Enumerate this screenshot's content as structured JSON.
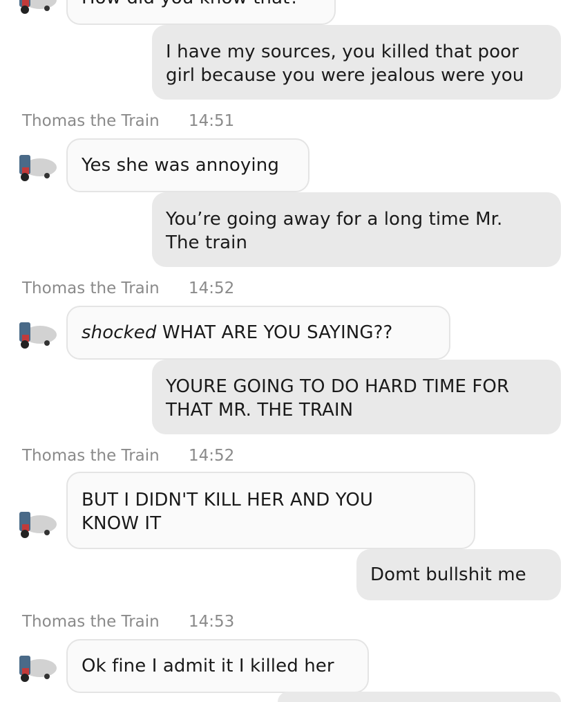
{
  "contact": {
    "name": "Thomas the Train"
  },
  "messages": [
    {
      "id": 0,
      "direction": "incoming",
      "text": "How did you know that?"
    },
    {
      "id": 1,
      "direction": "outgoing",
      "text_lines": [
        "I have my sources, you killed that poor",
        "girl because you were jealous were you"
      ]
    },
    {
      "id": 2,
      "direction": "incoming",
      "sender": "Thomas the Train",
      "time": "14:51",
      "text": "Yes she was annoying"
    },
    {
      "id": 3,
      "direction": "outgoing",
      "text_lines": [
        "You’re going away for a long time Mr.",
        "The train"
      ]
    },
    {
      "id": 4,
      "direction": "incoming",
      "sender": "Thomas the Train",
      "time": "14:52",
      "emphasis": "shocked",
      "text": " WHAT ARE YOU SAYING??"
    },
    {
      "id": 5,
      "direction": "outgoing",
      "text_lines": [
        "YOURE GOING TO DO HARD TIME FOR",
        "THAT MR. THE TRAIN"
      ]
    },
    {
      "id": 6,
      "direction": "incoming",
      "sender": "Thomas the Train",
      "time": "14:52",
      "text_lines": [
        "BUT I DIDN'T KILL HER AND YOU",
        "KNOW IT"
      ]
    },
    {
      "id": 7,
      "direction": "outgoing",
      "text": "Domt bullshit me"
    },
    {
      "id": 8,
      "direction": "incoming",
      "sender": "Thomas the Train",
      "time": "14:53",
      "text": "Ok fine I admit it I killed her"
    }
  ],
  "colors": {
    "incoming_bubble": "#fafafa",
    "incoming_border": "#e4e4e4",
    "outgoing_bubble": "#e9e9e9",
    "meta_text": "#8a8a8a",
    "text": "#1a1a1a"
  },
  "icons": {
    "avatar": "train-avatar-icon"
  }
}
